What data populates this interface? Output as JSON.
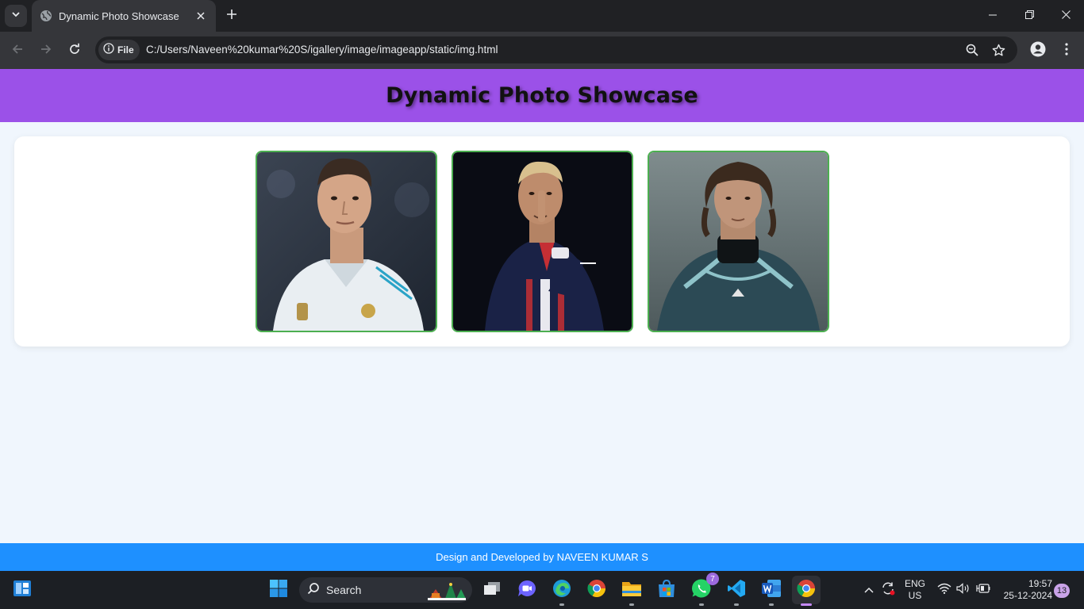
{
  "browser": {
    "tab_title": "Dynamic Photo Showcase",
    "site_chip_label": "File",
    "url": "C:/Users/Naveen%20kumar%20S/igallery/image/imageapp/static/img.html"
  },
  "page": {
    "title": "Dynamic Photo Showcase",
    "photos": [
      {
        "icon": "photo-player-white-kit"
      },
      {
        "icon": "photo-player-dark-kit"
      },
      {
        "icon": "photo-player-teal-kit"
      }
    ],
    "footer_text": "Design and Developed by NAVEEN KUMAR S"
  },
  "taskbar": {
    "search_label": "Search",
    "whatsapp_badge": "7",
    "language_line1": "ENG",
    "language_line2": "US",
    "time": "19:57",
    "date": "25-12-2024",
    "notification_count": "13"
  },
  "colors": {
    "header_bg": "#9b51e8",
    "footer_bg": "#1e90ff",
    "photo_border": "#4caf50",
    "page_bg": "#f0f6fd"
  }
}
